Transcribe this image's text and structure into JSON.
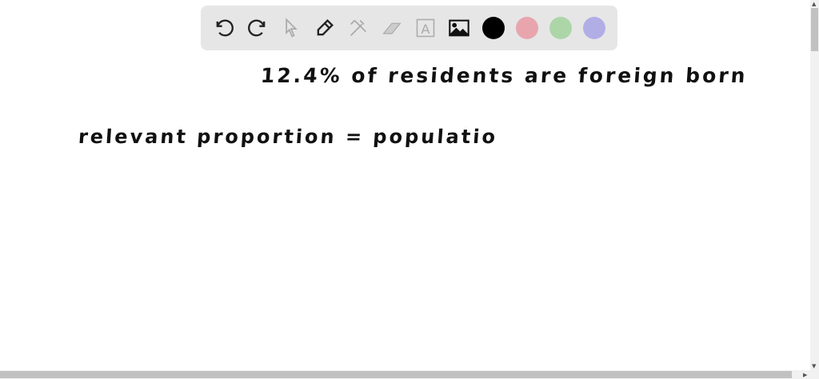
{
  "toolbar": {
    "tools": [
      {
        "name": "undo-icon",
        "label": "Undo"
      },
      {
        "name": "redo-icon",
        "label": "Redo"
      },
      {
        "name": "pointer-icon",
        "label": "Select"
      },
      {
        "name": "pencil-icon",
        "label": "Pen"
      },
      {
        "name": "tools-icon",
        "label": "Tools"
      },
      {
        "name": "eraser-icon",
        "label": "Eraser"
      },
      {
        "name": "text-icon",
        "label": "Text",
        "glyph": "A"
      },
      {
        "name": "image-icon",
        "label": "Image"
      }
    ],
    "colors": [
      "#000000",
      "#e8a5ae",
      "#acd6a8",
      "#b1aee6"
    ]
  },
  "canvas": {
    "line1": "12.4% of residents are foreign born",
    "line2": "relevant proportion = populatio"
  },
  "scrollbars": {
    "up": "▲",
    "down": "▼",
    "right": "▶",
    "left": "◀"
  }
}
